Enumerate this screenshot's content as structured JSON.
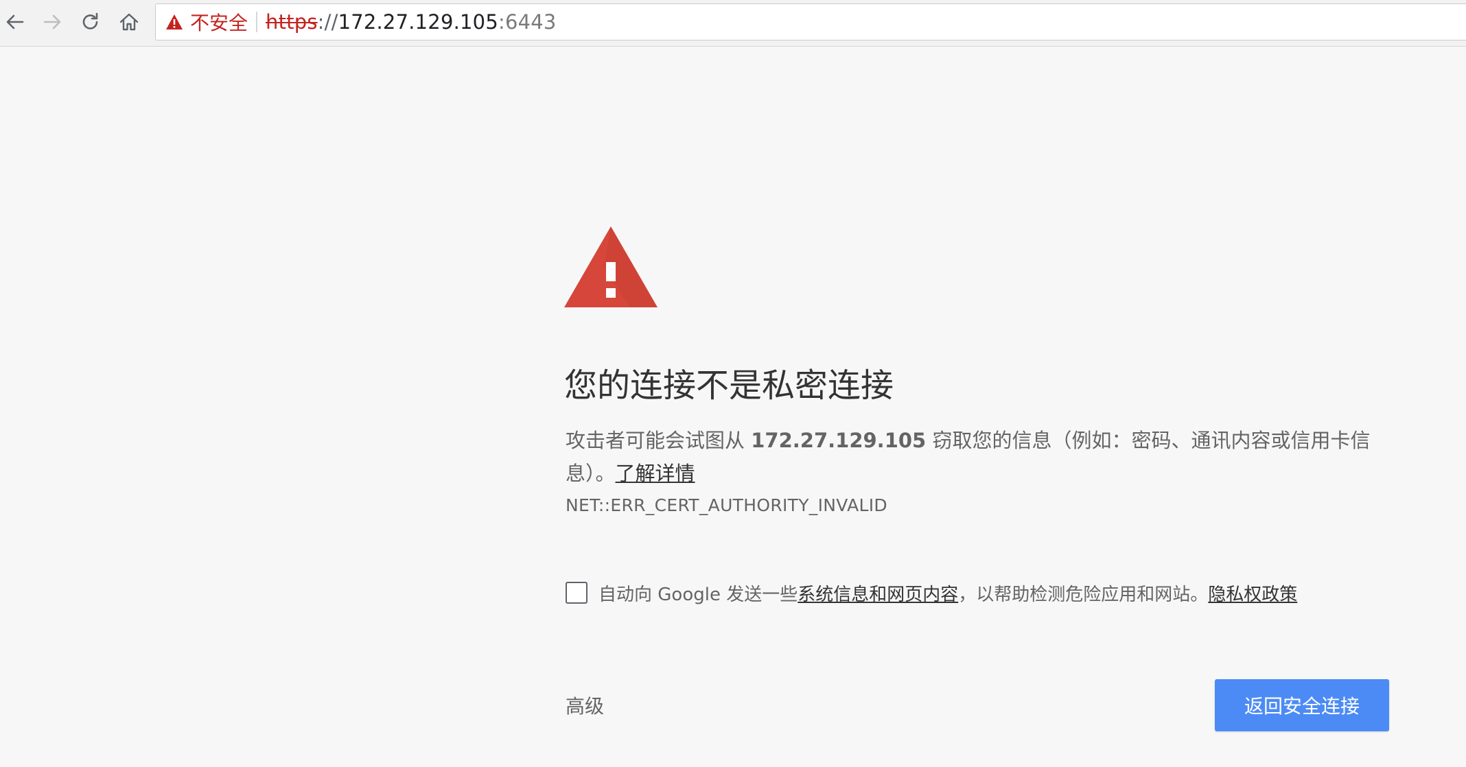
{
  "toolbar": {
    "icons": {
      "back": "back-arrow-icon",
      "forward": "forward-arrow-icon",
      "reload": "reload-icon",
      "home": "home-icon"
    },
    "security_chip": {
      "icon": "warning-triangle-icon",
      "label": "不安全"
    },
    "url": {
      "scheme": "https",
      "separator": "://",
      "host": "172.27.129.105",
      "port": ":6443"
    }
  },
  "interstitial": {
    "icon": "warning-triangle-icon",
    "heading": "您的连接不是私密连接",
    "explanation": {
      "before_host": "攻击者可能会试图从 ",
      "host": "172.27.129.105",
      "after_host": " 窃取您的信息（例如：密码、通讯内容或信用卡信息）。",
      "learn_more": "了解详情"
    },
    "error_code": "NET::ERR_CERT_AUTHORITY_INVALID",
    "report_checkbox": {
      "checked": false,
      "text_before": "自动向 Google 发送一些",
      "link_system_info": "系统信息和网页内容",
      "text_middle": "，以帮助检测危险应用和网站。",
      "link_privacy": "隐私权政策"
    },
    "advanced_label": "高级",
    "primary_button_label": "返回安全连接"
  },
  "colors": {
    "page_background": "#f7f7f7",
    "danger_red": "#c5221f",
    "warning_icon_red": "#d6463a",
    "primary_blue": "#4c8bf5",
    "body_text": "#646464",
    "heading_text": "#333333"
  }
}
